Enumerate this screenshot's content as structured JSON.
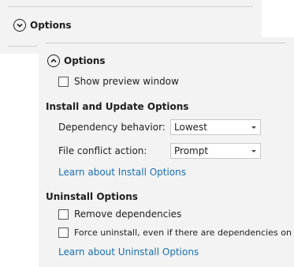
{
  "back_panel": {
    "options_title": "Options",
    "expander_icon": "chevron-down-circle-icon"
  },
  "front_panel": {
    "options_title": "Options",
    "expander_icon": "chevron-up-circle-icon",
    "show_preview": {
      "label": "Show preview window",
      "checked": false
    },
    "install_update": {
      "heading": "Install and Update Options",
      "dependency_behavior": {
        "label": "Dependency behavior:",
        "value": "Lowest"
      },
      "file_conflict": {
        "label": "File conflict action:",
        "value": "Prompt"
      },
      "link": "Learn about Install Options"
    },
    "uninstall": {
      "heading": "Uninstall Options",
      "remove_dependencies": {
        "label": "Remove dependencies",
        "checked": false
      },
      "force_uninstall": {
        "label": "Force uninstall, even if there are dependencies on it",
        "checked": false
      },
      "link": "Learn about Uninstall Options"
    }
  },
  "colors": {
    "panel_bg": "#f3f3f3",
    "link": "#1a6fb3",
    "text": "#1e1e1e"
  }
}
